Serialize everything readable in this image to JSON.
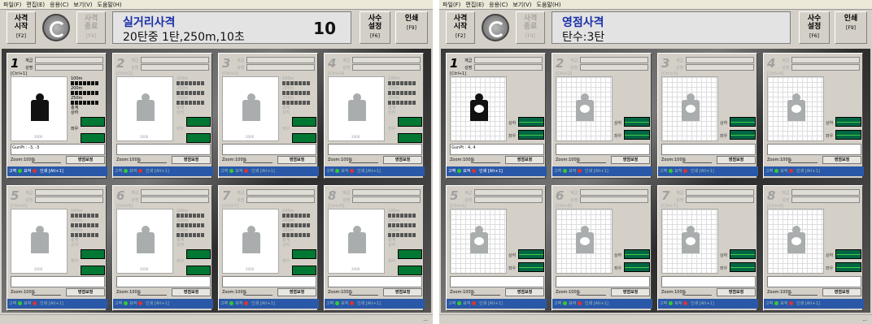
{
  "menu": [
    "파일(F)",
    "편집(E)",
    "응용(C)",
    "보기(V)",
    "도움말(H)"
  ],
  "left": {
    "start_label": "사격",
    "start_label2": "시작",
    "start_key": "[F2]",
    "end_label": "사격",
    "end_label2": "종료",
    "end_key": "[F4]",
    "title": "실거리사격",
    "subtitle": "20탄중  1탄,250m,10초",
    "count": "10",
    "setup_label": "사수",
    "setup_label2": "설정",
    "setup_key": "[F6]",
    "print_label": "인쇄",
    "print_key": "[F9]",
    "status": "..."
  },
  "right": {
    "start_label": "사격",
    "start_label2": "시작",
    "start_key": "[F2]",
    "end_label": "사격",
    "end_label2": "종료",
    "end_key": "[F4]",
    "title": "영점사격",
    "subtitle": "탄수:3탄",
    "setup_label": "사수",
    "setup_label2": "설정",
    "setup_key": "[F6]",
    "print_label": "인쇄",
    "print_key": "[F9]",
    "status": "..."
  },
  "panel": {
    "rank_label": "계급",
    "name_label": "성명",
    "zoom_label": "Zoom:100%",
    "view_button": "영점보정",
    "print_chk": "인쇄 [Alt+1]",
    "bottom_label": "고벽",
    "bottom_label2": "표적",
    "ud_label": "상하",
    "lr_label": "좌우",
    "total_label": "총계",
    "dist1": "100m",
    "dist2": "200m",
    "dist3": "250m",
    "gunpt_left": "GunPt : -3, -3",
    "gunpt_right": "GunPt : 4, 4",
    "sig": "2000"
  },
  "lanes": [
    {
      "num": "1",
      "ctl": "[Ctrl+1]"
    },
    {
      "num": "2",
      "ctl": "[Ctrl+2]"
    },
    {
      "num": "3",
      "ctl": "[Ctrl+3]"
    },
    {
      "num": "4",
      "ctl": "[Ctrl+4]"
    },
    {
      "num": "5",
      "ctl": "[Ctrl+5]"
    },
    {
      "num": "6",
      "ctl": "[Ctrl+6]"
    },
    {
      "num": "7",
      "ctl": "[Ctrl+7]"
    },
    {
      "num": "8",
      "ctl": "[Ctrl+8]"
    }
  ]
}
